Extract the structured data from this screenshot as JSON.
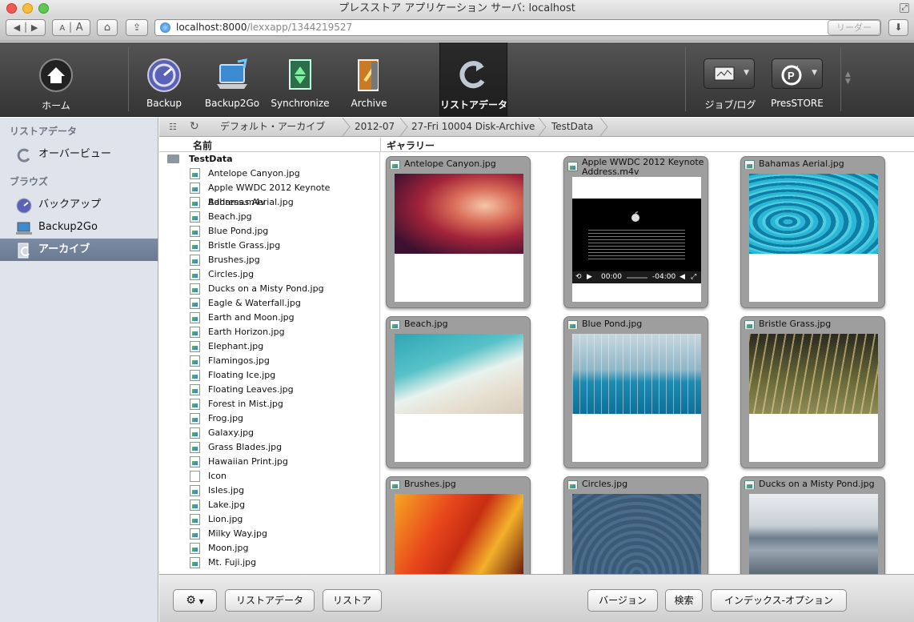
{
  "window": {
    "title": "プレスストア アプリケーション サーバ: localhost"
  },
  "browser": {
    "url_host": "localhost:8000",
    "url_path": "/lexxapp/1344219527",
    "font_small": "A",
    "font_large": "A",
    "reader_label": "リーダー"
  },
  "toolbar": {
    "home": "ホーム",
    "backup": "Backup",
    "backup2go": "Backup2Go",
    "synchronize": "Synchronize",
    "archive": "Archive",
    "restore_data": "リストアデータ",
    "jobs_log": "ジョブ/ログ",
    "presstore": "PresSTORE"
  },
  "sidebar": {
    "restore_header": "リストアデータ",
    "overview": "オーバービュー",
    "browse_header": "ブラウズ",
    "backup": "バックアップ",
    "backup2go": "Backup2Go",
    "archive": "アーカイブ"
  },
  "breadcrumb": [
    "デフォルト・アーカイブ",
    "2012-07",
    "27-Fri 10004 Disk-Archive",
    "TestData"
  ],
  "columns": {
    "name": "名前",
    "gallery": "ギャラリー"
  },
  "files": {
    "folder": "TestData",
    "items": [
      "Antelope Canyon.jpg",
      "Apple WWDC 2012 Keynote Address.m4v",
      "Bahamas Aerial.jpg",
      "Beach.jpg",
      "Blue Pond.jpg",
      "Bristle Grass.jpg",
      "Brushes.jpg",
      "Circles.jpg",
      "Ducks on a Misty Pond.jpg",
      "Eagle & Waterfall.jpg",
      "Earth and Moon.jpg",
      "Earth Horizon.jpg",
      "Elephant.jpg",
      "Flamingos.jpg",
      "Floating Ice.jpg",
      "Floating Leaves.jpg",
      "Forest in Mist.jpg",
      "Frog.jpg",
      "Galaxy.jpg",
      "Grass Blades.jpg",
      "Hawaiian Print.jpg",
      "Icon",
      "Isles.jpg",
      "Lake.jpg",
      "Lion.jpg",
      "Milky Way.jpg",
      "Moon.jpg",
      "Mt. Fuji.jpg"
    ]
  },
  "gallery": {
    "cards": [
      "Antelope Canyon.jpg",
      "Apple WWDC 2012 Keynote Address.m4v",
      "Bahamas Aerial.jpg",
      "Beach.jpg",
      "Blue Pond.jpg",
      "Bristle Grass.jpg",
      "Brushes.jpg",
      "Circles.jpg",
      "Ducks on a Misty Pond.jpg"
    ],
    "video": {
      "time_current": "00:00",
      "time_remaining": "-04:00"
    }
  },
  "bottom": {
    "restore_data": "リストアデータ",
    "restore": "リストア",
    "version": "バージョン",
    "search": "検索",
    "index_options": "インデックス-オプション"
  },
  "colors": {
    "toolbar_bg": "#3f3f3f",
    "sidebar_bg": "#dfe4ec",
    "sidebar_selected": "#71819a"
  }
}
